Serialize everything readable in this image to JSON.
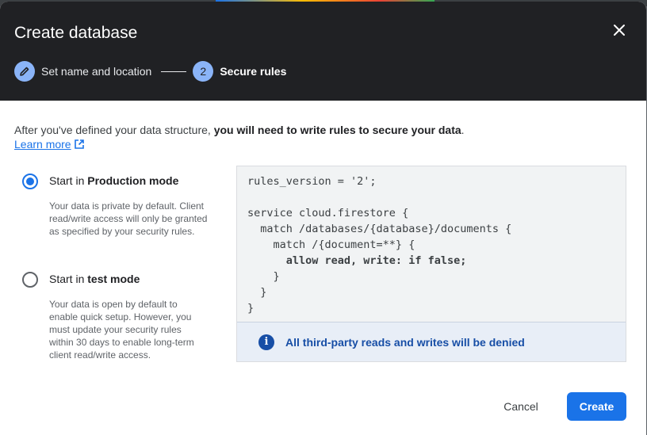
{
  "dialog": {
    "title": "Create database"
  },
  "icons": {
    "close": "close-icon",
    "step_done": "pencil-icon",
    "external": "open-in-new-icon",
    "info": "info-icon"
  },
  "stepper": {
    "steps": [
      {
        "label": "Set name and location",
        "state": "done"
      },
      {
        "number": "2",
        "label": "Secure rules",
        "state": "active"
      }
    ]
  },
  "intro": {
    "text_before": "After you've defined your data structure, ",
    "text_bold": "you will need to write rules to secure your data",
    "text_after": ".",
    "learn_more": "Learn more"
  },
  "modes": [
    {
      "prefix": "Start in ",
      "name": "Production mode",
      "checked": true,
      "description": "Your data is private by default. Client read/write access will only be granted as specified by your security rules."
    },
    {
      "prefix": "Start in ",
      "name": "test mode",
      "checked": false,
      "description": "Your data is open by default to enable quick setup. However, you must update your security rules within 30 days to enable long-term client read/write access."
    }
  ],
  "rules": {
    "lines": [
      "rules_version = '2';",
      "",
      "service cloud.firestore {",
      "  match /databases/{database}/documents {",
      "    match /{document=**} {",
      "      allow read, write: if false;",
      "    }",
      "  }",
      "}"
    ],
    "info": "All third-party reads and writes will be denied"
  },
  "actions": {
    "cancel": "Cancel",
    "create": "Create"
  },
  "colors": {
    "accent": "#1a73e8",
    "header_bg": "#202124",
    "step_circle": "#8ab4f8",
    "info_text": "#174ea6"
  }
}
